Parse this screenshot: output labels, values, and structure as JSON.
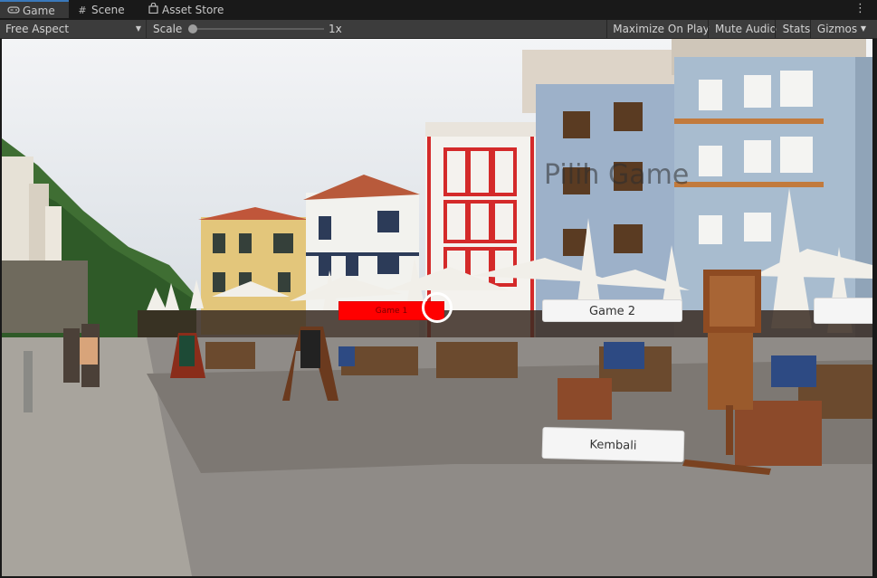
{
  "tabs": [
    {
      "label": "Game",
      "icon": "gamepad-icon",
      "active": true
    },
    {
      "label": "Scene",
      "icon": "grid-icon",
      "active": false
    },
    {
      "label": "Asset Store",
      "icon": "store-bag-icon",
      "active": false
    }
  ],
  "toolbar": {
    "aspect": "Free Aspect",
    "scale_label": "Scale",
    "scale_value": "1x",
    "scale_fraction": 0.0,
    "maximize_on_play": "Maximize On Play",
    "mute_audio": "Mute Audio",
    "stats": "Stats",
    "gizmos": "Gizmos"
  },
  "game_view": {
    "title_text": "Pilih Game",
    "buttons": {
      "game1": "Game 1",
      "game2": "Game 2",
      "game3": "",
      "back": "Kembali"
    }
  },
  "colors": {
    "tab_accent": "#3a79bb",
    "game1_button": "#ff0000"
  }
}
